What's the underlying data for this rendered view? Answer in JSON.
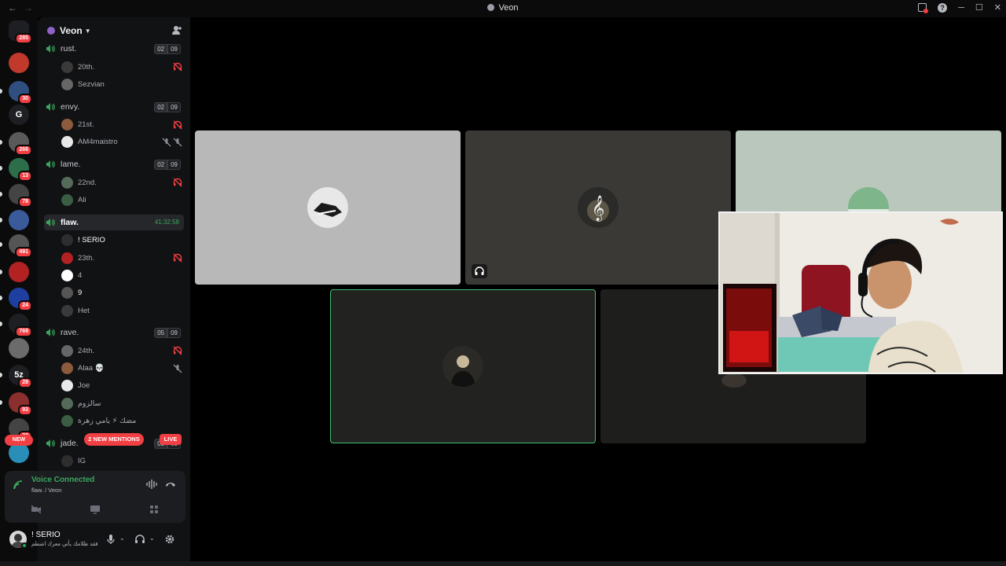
{
  "window": {
    "title": "Veon"
  },
  "servers": [
    {
      "label": "",
      "badge": "285",
      "color": "#1e1f22"
    },
    {
      "label": "",
      "badge": "",
      "color": "#c0392b"
    },
    {
      "label": "",
      "badge": "30",
      "color": "#2f4f7f"
    },
    {
      "label": "G",
      "badge": "",
      "color": "#1e1f22"
    },
    {
      "label": "",
      "badge": "266",
      "color": "#5a5a5a"
    },
    {
      "label": "",
      "badge": "13",
      "color": "#2c6e49"
    },
    {
      "label": "",
      "badge": "78",
      "color": "#444"
    },
    {
      "label": "",
      "badge": "",
      "color": "#3a5a9a"
    },
    {
      "label": "",
      "badge": "491",
      "color": "#555"
    },
    {
      "label": "",
      "badge": "",
      "color": "#b22222"
    },
    {
      "label": "",
      "badge": "24",
      "color": "#1f3fa0"
    },
    {
      "label": "",
      "badge": "769",
      "color": "#1e1f22"
    },
    {
      "label": "",
      "badge": "",
      "color": "#6b6b6b"
    },
    {
      "label": "5z",
      "badge": "28",
      "color": "#1e1f22"
    },
    {
      "label": "",
      "badge": "93",
      "color": "#8b2e2e"
    },
    {
      "label": "",
      "badge": "30",
      "color": "#444"
    },
    {
      "label": "",
      "badge": "",
      "color": "#2a8fb8"
    }
  ],
  "rail": {
    "new_label": "NEW"
  },
  "guild": {
    "name": "Veon"
  },
  "channels": [
    {
      "name": "rust.",
      "count_a": "02",
      "count_b": "09",
      "users": [
        {
          "name": "20th.",
          "status": "deafened"
        },
        {
          "name": "Sezvian",
          "status": ""
        }
      ]
    },
    {
      "name": "envy.",
      "count_a": "02",
      "count_b": "09",
      "users": [
        {
          "name": "21st.",
          "status": "deafened"
        },
        {
          "name": "AM4maistro",
          "status": "muted-video"
        }
      ]
    },
    {
      "name": "lame.",
      "count_a": "02",
      "count_b": "09",
      "users": [
        {
          "name": "22nd.",
          "status": "deafened"
        },
        {
          "name": "Ali",
          "status": ""
        }
      ]
    },
    {
      "name": "flaw.",
      "timer": "41:32:58",
      "users": [
        {
          "name": "! SERIO",
          "status": ""
        },
        {
          "name": "23th.",
          "status": "deafened"
        },
        {
          "name": "4",
          "status": ""
        },
        {
          "name": "9",
          "status": ""
        },
        {
          "name": "Het",
          "status": ""
        }
      ]
    },
    {
      "name": "rave.",
      "count_a": "05",
      "count_b": "09",
      "users": [
        {
          "name": "24th.",
          "status": "deafened"
        },
        {
          "name": "Alaa 💀",
          "status": "muted"
        },
        {
          "name": "Joe",
          "status": ""
        },
        {
          "name": "سالزوم",
          "status": ""
        },
        {
          "name": "مضك ⚡ يامي زهرة",
          "status": ""
        }
      ]
    },
    {
      "name": "jade.",
      "count_a": "05",
      "count_b": "09",
      "users": [
        {
          "name": "IG",
          "status": ""
        }
      ]
    }
  ],
  "pills": {
    "mentions": "2 NEW MENTIONS",
    "live": "LIVE"
  },
  "voice": {
    "title": "Voice Connected",
    "subtitle": "flaw. / Veon"
  },
  "user": {
    "name": "! SERIO",
    "status": "فقد ظلامك يأتي معرك اضطم"
  },
  "colors": {
    "accent_green": "#23a55a",
    "danger": "#f23f43",
    "speaking_border": "#3fbf6f"
  }
}
